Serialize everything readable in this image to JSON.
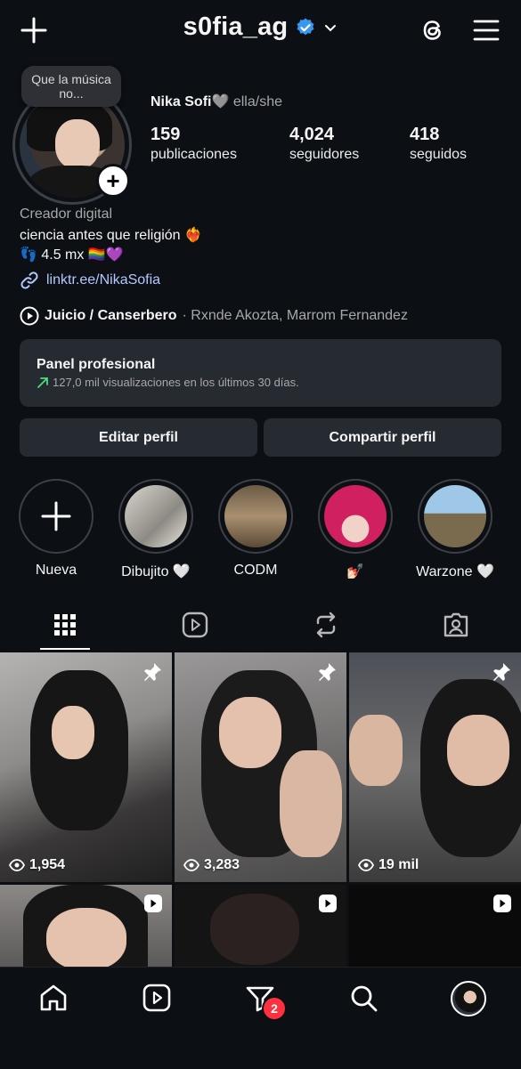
{
  "header": {
    "username": "s0fia_ag",
    "icons": [
      "plus-icon",
      "verified-badge-icon",
      "chevron-down-icon",
      "threads-icon",
      "menu-icon"
    ]
  },
  "note": {
    "text": "Que la música no..."
  },
  "profile": {
    "name": "Nika Sofi🩶",
    "pronouns": "ella/she",
    "stats": [
      {
        "value": "159",
        "label": "publicaciones"
      },
      {
        "value": "4,024",
        "label": "seguidores"
      },
      {
        "value": "418",
        "label": "seguidos"
      }
    ],
    "category": "Creador digital",
    "bio_line1": "ciencia antes que religión ❤️‍🔥",
    "bio_line2": "👣 4.5 mx 🏳️‍🌈💜",
    "link": "linktr.ee/NikaSofia"
  },
  "music": {
    "song": "Juicio / Canserbero",
    "artists": "· Rxnde Akozta, Marrom Fernandez"
  },
  "panel": {
    "title": "Panel profesional",
    "subtitle": "127,0 mil visualizaciones en los últimos 30 días."
  },
  "buttons": {
    "edit": "Editar perfil",
    "share": "Compartir perfil"
  },
  "highlights": [
    {
      "label": "Nueva"
    },
    {
      "label": "Dibujito 🤍"
    },
    {
      "label": "CODM"
    },
    {
      "label": "💅🏻"
    },
    {
      "label": "Warzone 🤍"
    }
  ],
  "tabs": [
    "grid-tab",
    "reels-tab",
    "reposts-tab",
    "tagged-tab"
  ],
  "posts": [
    {
      "views": "1,954",
      "pinned": true
    },
    {
      "views": "3,283",
      "pinned": true
    },
    {
      "views": "19 mil",
      "pinned": true
    },
    {
      "views": "",
      "reel": true
    },
    {
      "views": "",
      "reel": true
    },
    {
      "views": "",
      "reel": true
    }
  ],
  "nav": {
    "notifications_count": "2"
  },
  "colors": {
    "background": "#0c0f14",
    "surface": "#262a31",
    "link": "#b3c8ff",
    "verified": "#3897f0",
    "badge": "#ff3040"
  }
}
